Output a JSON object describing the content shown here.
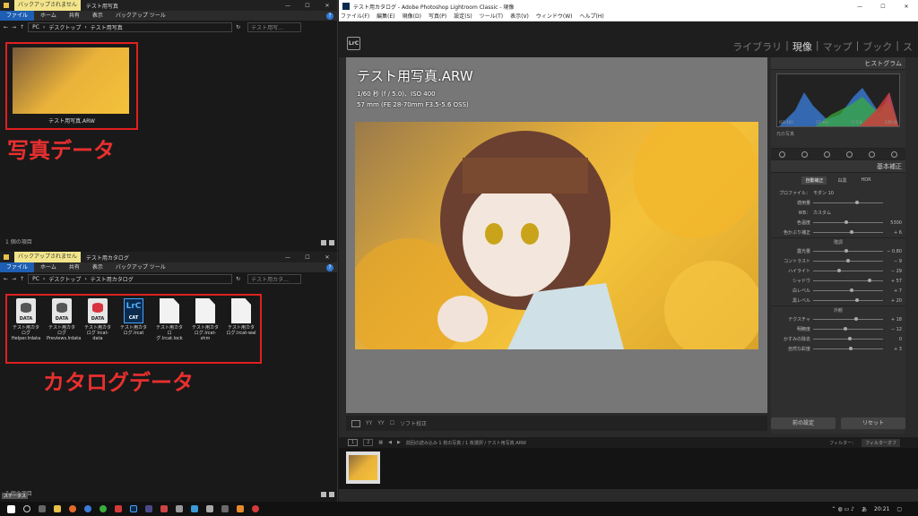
{
  "explorer1": {
    "ribbon_context": "バックアップされません",
    "title": "テスト用写真",
    "tabs": [
      "ファイル",
      "ホーム",
      "共有",
      "表示"
    ],
    "context_tab": "バックアップ ツール",
    "path": [
      "PC",
      "デスクトップ",
      "テスト用写真"
    ],
    "search_placeholder": "テスト用写...",
    "file": {
      "name": "テスト用写真.ARW"
    },
    "annotation": "写真データ",
    "status": "1 個の項目"
  },
  "explorer2": {
    "ribbon_context": "バックアップされません",
    "title": "テスト用カタログ",
    "tabs": [
      "ファイル",
      "ホーム",
      "共有",
      "表示"
    ],
    "context_tab": "バックアップ ツール",
    "path": [
      "PC",
      "デスクトップ",
      "テスト用カタログ"
    ],
    "search_placeholder": "テスト用カタ...",
    "files": [
      {
        "name": "テスト用カタログ Helper.lrdata",
        "icon": "database-icon"
      },
      {
        "name": "テスト用カタログ Previews.lrdata",
        "icon": "database-icon"
      },
      {
        "name": "テスト用カタログ lrcat-data",
        "icon": "database-red-icon"
      },
      {
        "name": "テスト用カタログ.lrcat",
        "icon": "lrcat-icon"
      },
      {
        "name": "テスト用カタログ.lrcat.lock",
        "icon": "document-icon"
      },
      {
        "name": "テスト用カタログ.lrcat-shm",
        "icon": "document-icon"
      },
      {
        "name": "テスト用カタログ.lrcat-wal",
        "icon": "document-icon"
      }
    ],
    "annotation": "カタログデータ",
    "status": "7 個の項目"
  },
  "lightroom": {
    "title": "テスト用カタログ - Adobe Photoshop Lightroom Classic - 現像",
    "menu": [
      "ファイル(F)",
      "編集(E)",
      "現像(D)",
      "写真(P)",
      "設定(S)",
      "ツール(T)",
      "表示(V)",
      "ウィンドウ(W)",
      "ヘルプ(H)"
    ],
    "logo": "LrC",
    "modules": [
      "ライブラリ",
      "現像",
      "マップ",
      "ブック",
      "ス"
    ],
    "active_module": "現像",
    "overlay": {
      "filename": "テスト用写真.ARW",
      "exposure": "1/60 秒 (f / 5.0)、ISO 400",
      "lens": "57 mm (FE 28-70mm F3.5-5.6 OSS)"
    },
    "panel": {
      "histogram_title": "ヒストグラム",
      "histogram_axis": [
        "ISO 400",
        "57 mm",
        "f / 5.0",
        "1/60 秒"
      ],
      "original_photo": "元の写真",
      "basic_title": "基本補正",
      "treatment_tabs": [
        "自動補正",
        "白黒",
        "HDR"
      ],
      "profile_label": "プロファイル：",
      "profile_value": "モダン 10",
      "amount_label": "適用量",
      "wb_label": "WB：",
      "wb_value": "カスタム",
      "sliders1": [
        {
          "name": "色温度",
          "value": "5300"
        },
        {
          "name": "色かぶり補正",
          "value": "+ 6"
        }
      ],
      "tone_title": "階調",
      "sliders2": [
        {
          "name": "露光量",
          "value": "− 0.80"
        },
        {
          "name": "コントラスト",
          "value": "− 9"
        },
        {
          "name": "ハイライト",
          "value": "− 29"
        },
        {
          "name": "シャドウ",
          "value": "+ 57"
        },
        {
          "name": "白レベル",
          "value": "+ 7"
        },
        {
          "name": "黒レベル",
          "value": "+ 20"
        }
      ],
      "presence_title": "外観",
      "sliders3": [
        {
          "name": "テクスチャ",
          "value": "+ 18"
        },
        {
          "name": "明瞭度",
          "value": "− 12"
        },
        {
          "name": "かすみの除去",
          "value": "0"
        },
        {
          "name": "自然な彩度",
          "value": "+ 3"
        }
      ]
    },
    "buttons": {
      "previous": "前の設定",
      "reset": "リセット"
    },
    "toolbar": {
      "soft_proof": "ソフト校正"
    },
    "filmstrip": {
      "pages": [
        "1",
        "2"
      ],
      "source": "前回の読み込み  1 枚の写真 / 1 枚選択 / テスト用写真.ARW",
      "filter_label": "フィルター：",
      "filter_value": "フィルターオフ"
    }
  },
  "taskbar": {
    "time": "20:21",
    "lang": "あ"
  },
  "stats": "ステータス"
}
